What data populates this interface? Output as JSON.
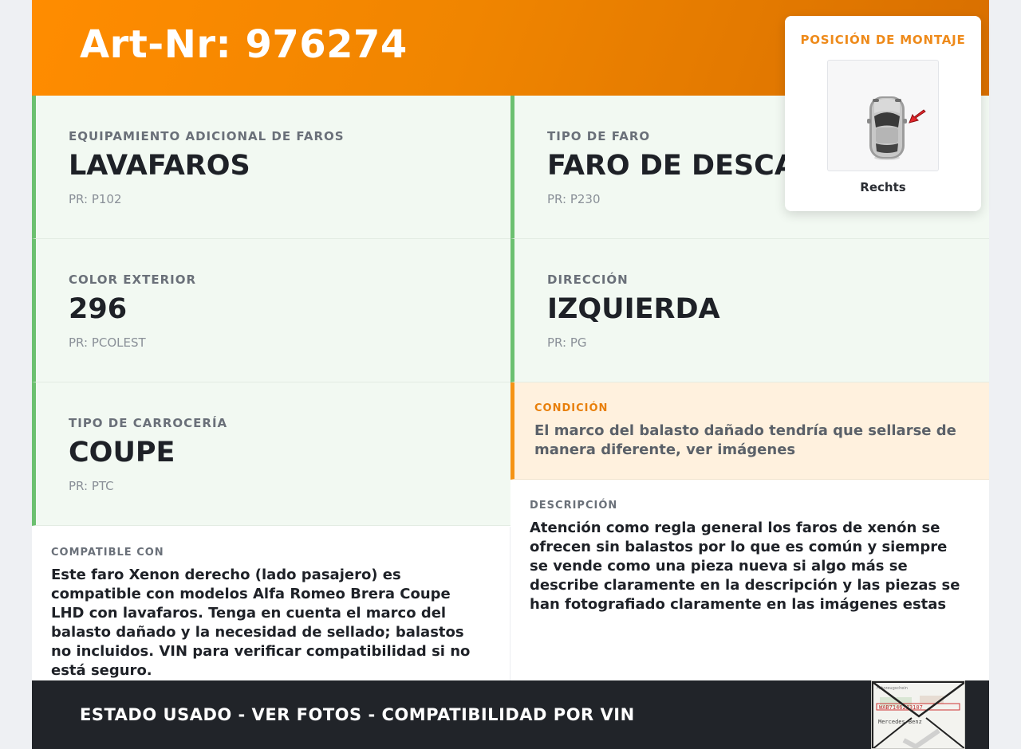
{
  "header": {
    "title": "Art-Nr: 976274"
  },
  "attributes": [
    {
      "label": "EQUIPAMIENTO ADICIONAL DE FAROS",
      "value": "LAVAFAROS",
      "pr": "PR: P102"
    },
    {
      "label": "TIPO DE FARO",
      "value": "FARO DE DESCARGA",
      "pr": "PR: P230"
    },
    {
      "label": "COLOR EXTERIOR",
      "value": "296",
      "pr": "PR: PCOLEST"
    },
    {
      "label": "DIRECCIÓN",
      "value": "IZQUIERDA",
      "pr": "PR: PG"
    },
    {
      "label": "TIPO DE CARROCERÍA",
      "value": "COUPE",
      "pr": "PR: PTC"
    }
  ],
  "condition": {
    "label": "CONDICIÓN",
    "text": "El marco del balasto dañado tendría que sellarse de manera diferente, ver imágenes"
  },
  "compatible": {
    "label": "COMPATIBLE CON",
    "text": "Este faro Xenon derecho (lado pasajero) es compatible con modelos Alfa Romeo Brera Coupe LHD con lavafaros. Tenga en cuenta el marco del balasto dañado y la necesidad de sellado; balastos no incluidos. VIN para verificar compatibilidad si no está seguro."
  },
  "description": {
    "label": "DESCRIPCIÓN",
    "text": "Atención como regla general los faros de xenón se ofrecen sin balastos por lo que es común y siempre se vende como una pieza nueva si algo más se describe claramente en la descripción y las piezas se han fotografiado claramente en las imágenes estas"
  },
  "mounting": {
    "title": "POSICIÓN DE MONTAJE",
    "side": "Rechts",
    "icon": "car-top-view-icon"
  },
  "footer": {
    "text": "ESTADO USADO - VER FOTOS - COMPATIBILIDAD POR VIN",
    "thumbnail": {
      "icon": "vin-document-thumbnail",
      "doc_label": "Fahrzeugschein",
      "vin": "WAB71462J3107",
      "brand": "Mercedes-Benz"
    }
  },
  "colors": {
    "header_orange": "#ff8c00",
    "green_accent": "#6cc070",
    "condition_accent": "#f59314",
    "footer_bg": "#212429",
    "arrow_red": "#e3262b"
  }
}
